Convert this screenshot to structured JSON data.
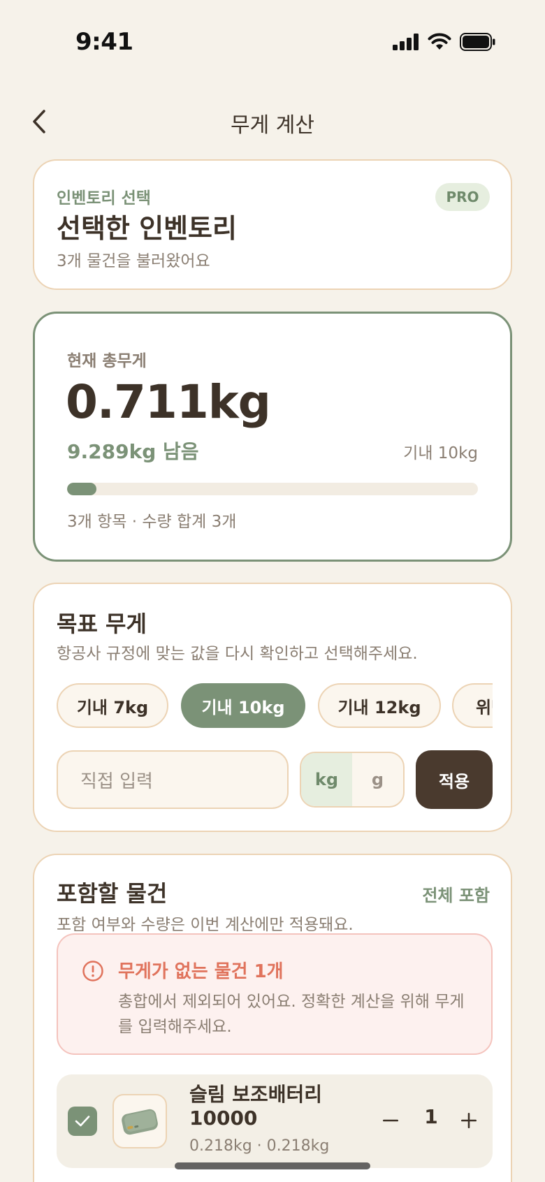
{
  "status_bar": {
    "time": "9:41"
  },
  "header": {
    "title": "무게 계산"
  },
  "inventory": {
    "subtitle": "인벤토리 선택",
    "title": "선택한 인벤토리",
    "description": "3개 물건을 불러왔어요",
    "badge": "PRO"
  },
  "weight": {
    "label": "현재 총무게",
    "total": "0.711kg",
    "remaining": "9.289kg 남음",
    "limit": "기내 10kg",
    "progress_fraction": 0.0711,
    "summary": "3개 항목 · 수량 합계 3개"
  },
  "target": {
    "title": "목표 무게",
    "description": "항공사 규정에 맞는 값을 다시 확인하고 선택해주세요.",
    "chips": [
      {
        "label": "기내 7kg",
        "selected": false
      },
      {
        "label": "기내 10kg",
        "selected": true
      },
      {
        "label": "기내 12kg",
        "selected": false
      },
      {
        "label": "위탁",
        "selected": false
      }
    ],
    "custom_placeholder": "직접 입력",
    "units": [
      "kg",
      "g"
    ],
    "active_unit": "kg",
    "apply_label": "적용"
  },
  "items": {
    "title": "포함할 물건",
    "include_all": "전체 포함",
    "description": "포함 여부와 수량은 이번 계산에만 적용돼요.",
    "warning": {
      "title": "무게가 없는 물건 1개",
      "body": "총합에서 제외되어 있어요. 정확한 계산을 위해 무게를 입력해주세요."
    },
    "list": [
      {
        "name": "슬림 보조배터리 10000",
        "weight": "0.218kg · 0.218kg",
        "quantity": "1",
        "checked": true
      }
    ]
  },
  "colors": {
    "accent": "#7b9277",
    "background": "#f6f2ea",
    "border": "#ecd3b4",
    "warning": "#e0735c",
    "dark_button": "#4a3a2e"
  }
}
